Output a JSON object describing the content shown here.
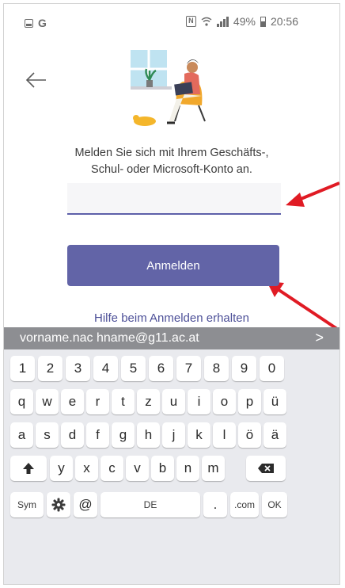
{
  "status_bar": {
    "left_letter": "G",
    "battery": "49%",
    "time": "20:56"
  },
  "login": {
    "prompt_line1": "Melden Sie sich mit Ihrem Geschäfts-,",
    "prompt_line2": "Schul- oder Microsoft-Konto an.",
    "email_value": "",
    "sign_in_label": "Anmelden",
    "help_link": "Hilfe beim Anmelden erhalten"
  },
  "keyboard": {
    "suggestion": "vorname.nac hname@g11.ac.at",
    "suggestion_chevron": ">",
    "row_numbers": [
      "1",
      "2",
      "3",
      "4",
      "5",
      "6",
      "7",
      "8",
      "9",
      "0"
    ],
    "row_1": [
      "q",
      "w",
      "e",
      "r",
      "t",
      "z",
      "u",
      "i",
      "o",
      "p",
      "ü"
    ],
    "row_2": [
      "a",
      "s",
      "d",
      "f",
      "g",
      "h",
      "j",
      "k",
      "l",
      "ö",
      "ä"
    ],
    "row_3": [
      "y",
      "x",
      "c",
      "v",
      "b",
      "n",
      "m"
    ],
    "sym_label": "Sym",
    "at_label": "@",
    "space_label": "DE",
    "dot_label": ".",
    "com_label": ".com",
    "ok_label": "OK"
  },
  "colors": {
    "accent": "#6264a7",
    "link": "#4d5098",
    "arrow": "#e01b24",
    "keyboard_bg": "#e9eaee",
    "suggestion_bg": "#8d8e92"
  },
  "icons": {
    "back": "arrow-left-icon",
    "gallery": "image-icon",
    "nfc": "nfc-icon",
    "wifi": "wifi-icon",
    "signal": "signal-icon",
    "battery": "battery-icon",
    "shift": "shift-icon",
    "backspace": "backspace-icon",
    "settings": "gear-icon"
  }
}
